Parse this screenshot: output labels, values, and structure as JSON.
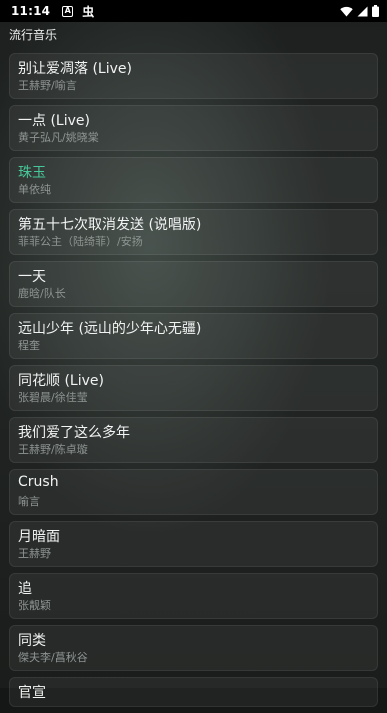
{
  "status_bar": {
    "time": "11:14",
    "notification_icon": "A",
    "bug_icon": "虫"
  },
  "header": {
    "title": "流行音乐"
  },
  "colors": {
    "active_title": "#47c89a"
  },
  "songs": [
    {
      "title": "别让爱凋落 (Live)",
      "artist": "王赫野/喻言",
      "active": false
    },
    {
      "title": "一点 (Live)",
      "artist": "黄子弘凡/姚晓棠",
      "active": false
    },
    {
      "title": "珠玉",
      "artist": "单依纯",
      "active": true
    },
    {
      "title": "第五十七次取消发送 (说唱版)",
      "artist": "菲菲公主（陆绮菲）/安扬",
      "active": false
    },
    {
      "title": "一天",
      "artist": "鹿晗/队长",
      "active": false
    },
    {
      "title": "远山少年 (远山的少年心无疆)",
      "artist": "程奎",
      "active": false
    },
    {
      "title": "同花顺 (Live)",
      "artist": "张碧晨/徐佳莹",
      "active": false
    },
    {
      "title": "我们爱了这么多年",
      "artist": "王赫野/陈卓璇",
      "active": false
    },
    {
      "title": "Crush",
      "artist": "喻言",
      "active": false
    },
    {
      "title": "月暗面",
      "artist": "王赫野",
      "active": false
    },
    {
      "title": "追",
      "artist": "张靓颖",
      "active": false
    },
    {
      "title": "同类",
      "artist": "傑夫李/菖秋谷",
      "active": false
    },
    {
      "title": "官宣",
      "artist": "",
      "active": false
    }
  ]
}
